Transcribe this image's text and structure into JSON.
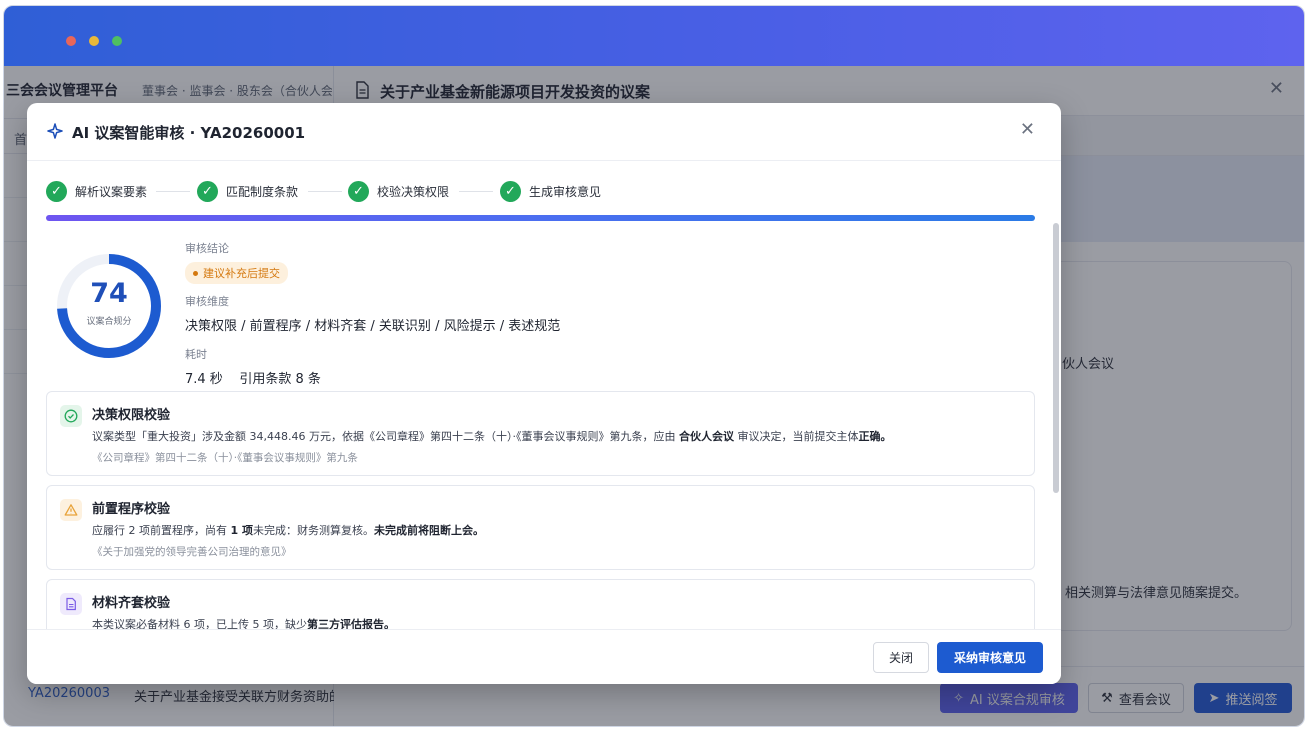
{
  "app": {
    "brand": "三会会议管理平台",
    "subtitle": "董事会 · 监事会 · 股东会（合伙人会",
    "tab_first": "首",
    "bottom_row": {
      "code": "YA20260003",
      "title": "关于产业基金接受关联方财务资助的"
    }
  },
  "panel": {
    "title": "关于产业基金新能源项目开发投资的议案",
    "text_right_1": "伙人会议",
    "text_right_2": "，相关测算与法律意见随案提交。",
    "buttons": {
      "ai": "AI 议案合规审核",
      "view": "查看会议",
      "push": "推送阅签"
    }
  },
  "modal": {
    "title": "AI 议案智能审核 · YA20260001",
    "steps": [
      "解析议案要素",
      "匹配制度条款",
      "校验决策权限",
      "生成审核意见"
    ],
    "progress": 1.0,
    "score": {
      "value": "74",
      "label": "议案合规分",
      "fraction": 0.74
    },
    "conclusion_label": "审核结论",
    "conclusion": "建议补充后提交",
    "dimension_label": "审核维度",
    "dimensions": "决策权限 / 前置程序 / 材料齐套 / 关联识别 / 风险提示 / 表述规范",
    "time_label": "耗时",
    "time_value": "7.4 秒    引用条款 8 条",
    "items": [
      {
        "title": "决策权限校验",
        "status": "pass",
        "desc_a": "议案类型「重大投资」涉及金额 34,448.46 万元，依据《公司章程》第四十二条（十）·《董事会议事规则》第九条，应由 ",
        "desc_b": "合伙人会议",
        "desc_c": " 审议决定，当前提交主体",
        "desc_d": "正确。",
        "ref": "《公司章程》第四十二条（十）·《董事会议事规则》第九条"
      },
      {
        "title": "前置程序校验",
        "status": "warn",
        "desc_a": "应履行 2 项前置程序，尚有 ",
        "desc_b": "1 项",
        "desc_c": "未完成：财务测算复核。",
        "desc_d": "未完成前将阻断上会。",
        "ref": "《关于加强党的领导完善公司治理的意见》"
      },
      {
        "title": "材料齐套校验",
        "status": "doc",
        "desc_a": "本类议案必备材料 6 项，已上传 5 项，缺少",
        "desc_b": "第三方评估报告。",
        "desc_c": "",
        "desc_d": "",
        "ref": ""
      }
    ],
    "buttons": {
      "close": "关闭",
      "adopt": "采纳审核意见"
    }
  },
  "colors": {
    "accent": "#1d5bd0",
    "pass": "#22a85a",
    "warn": "#e8a33a",
    "doc": "#7b5ce6"
  }
}
